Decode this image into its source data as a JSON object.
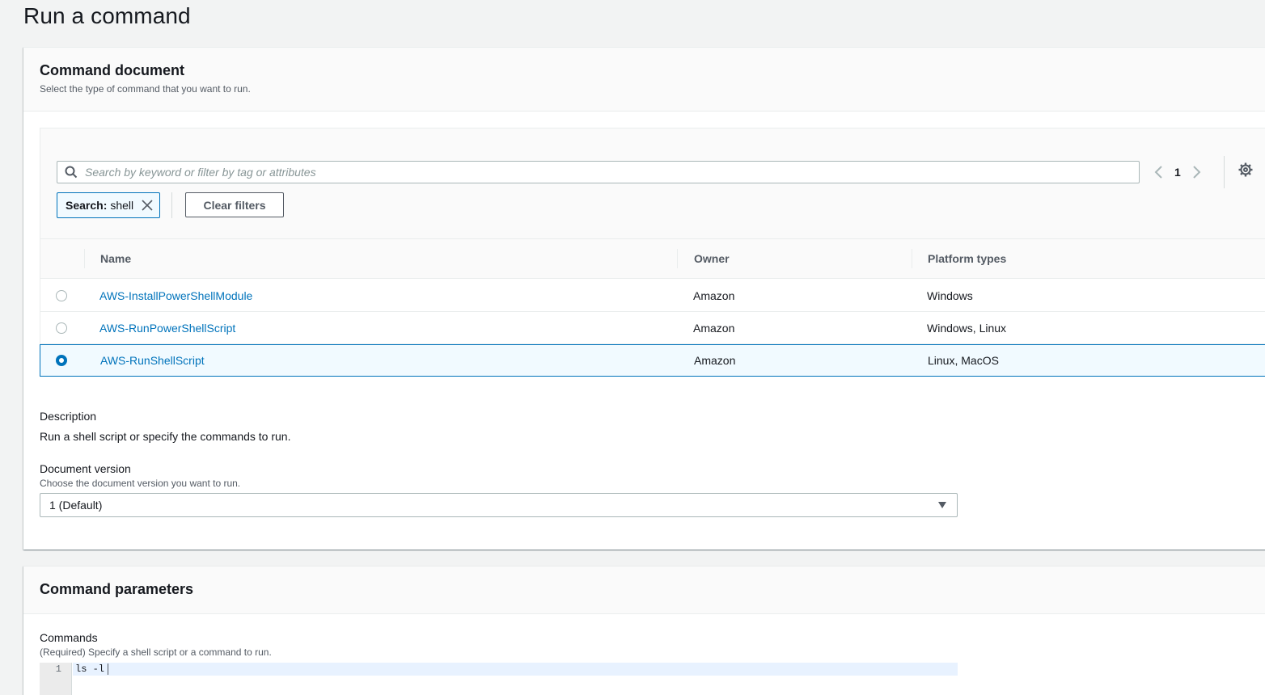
{
  "page": {
    "title": "Run a command"
  },
  "command_document": {
    "title": "Command document",
    "description": "Select the type of command that you want to run.",
    "search": {
      "placeholder": "Search by keyword or filter by tag or attributes",
      "value": ""
    },
    "filter_token": {
      "key": "Search:",
      "value": "shell"
    },
    "clear_filters_label": "Clear filters",
    "pagination": {
      "current_page": "1"
    },
    "table": {
      "columns": [
        "Name",
        "Owner",
        "Platform types"
      ],
      "rows": [
        {
          "name": "AWS-InstallPowerShellModule",
          "owner": "Amazon",
          "platforms": "Windows",
          "selected": false
        },
        {
          "name": "AWS-RunPowerShellScript",
          "owner": "Amazon",
          "platforms": "Windows, Linux",
          "selected": false
        },
        {
          "name": "AWS-RunShellScript",
          "owner": "Amazon",
          "platforms": "Linux, MacOS",
          "selected": true
        }
      ]
    },
    "doc_description": {
      "label": "Description",
      "value": "Run a shell script or specify the commands to run."
    },
    "document_version": {
      "label": "Document version",
      "description": "Choose the document version you want to run.",
      "selected": "1 (Default)"
    }
  },
  "command_parameters": {
    "title": "Command parameters",
    "commands": {
      "label": "Commands",
      "description": "(Required) Specify a shell script or a command to run.",
      "lines": [
        {
          "number": "1",
          "text": "ls -l"
        }
      ]
    }
  },
  "colors": {
    "accent": "#0073bb",
    "selected_row_bg": "#f1faff",
    "text": "#16191f",
    "muted": "#545b64"
  }
}
